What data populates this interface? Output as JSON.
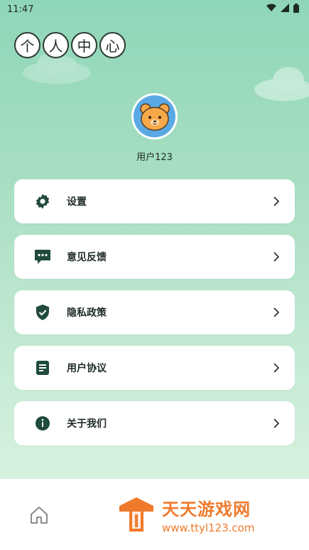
{
  "status_bar": {
    "time": "11:47",
    "icons": [
      "wifi-icon",
      "signal-icon",
      "battery-icon"
    ]
  },
  "header": {
    "title_chars": [
      "个",
      "人",
      "中",
      "心"
    ]
  },
  "profile": {
    "avatar_icon": "bear-avatar-icon",
    "username": "用户123"
  },
  "menu": {
    "items": [
      {
        "label": "设置",
        "icon": "gear-icon"
      },
      {
        "label": "意见反馈",
        "icon": "message-icon"
      },
      {
        "label": "隐私政策",
        "icon": "shield-check-icon"
      },
      {
        "label": "用户协议",
        "icon": "document-icon"
      },
      {
        "label": "关于我们",
        "icon": "info-icon"
      }
    ]
  },
  "bottom_nav": {
    "items": [
      {
        "icon": "home-icon"
      }
    ]
  },
  "watermark": {
    "title": "天天游戏网",
    "url": "www.ttyl123.com"
  },
  "colors": {
    "background_top": "#8fd6b8",
    "icon_dark_green": "#1f4a3c",
    "card": "#ffffff",
    "watermark_orange": "#f07a2c"
  }
}
